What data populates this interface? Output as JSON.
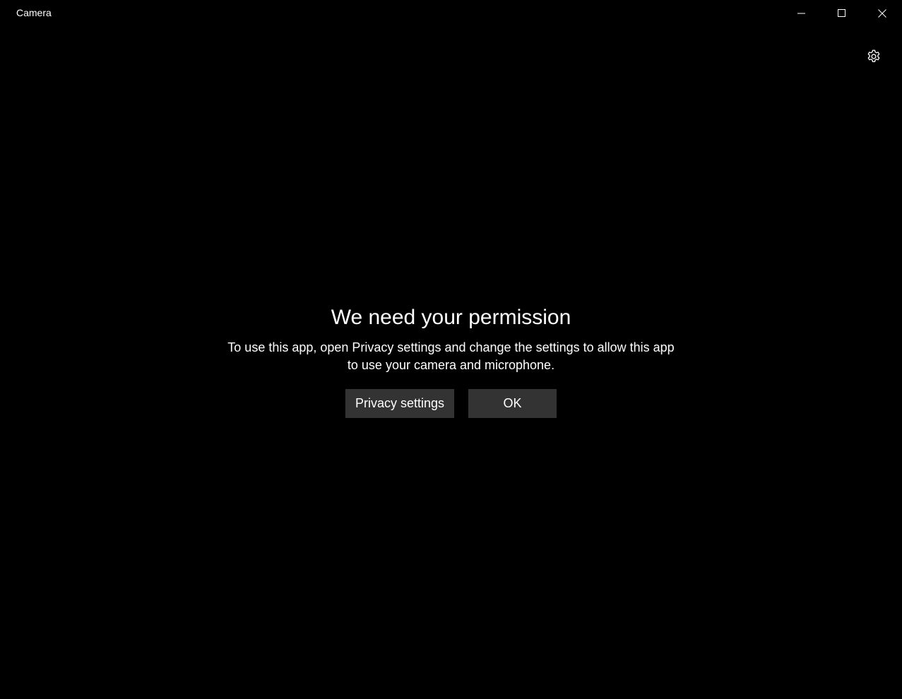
{
  "window": {
    "title": "Camera"
  },
  "caption": {
    "minimize_icon": "minimize-icon",
    "maximize_icon": "maximize-icon",
    "close_icon": "close-icon"
  },
  "toolbar": {
    "settings_icon": "gear-icon"
  },
  "dialog": {
    "title": "We need your permission",
    "message": "To use this app, open Privacy settings and change the settings to allow this app to use your camera and microphone.",
    "privacy_button_label": "Privacy settings",
    "ok_button_label": "OK"
  },
  "colors": {
    "background": "#000000",
    "text": "#ffffff",
    "button_background": "#333333"
  }
}
